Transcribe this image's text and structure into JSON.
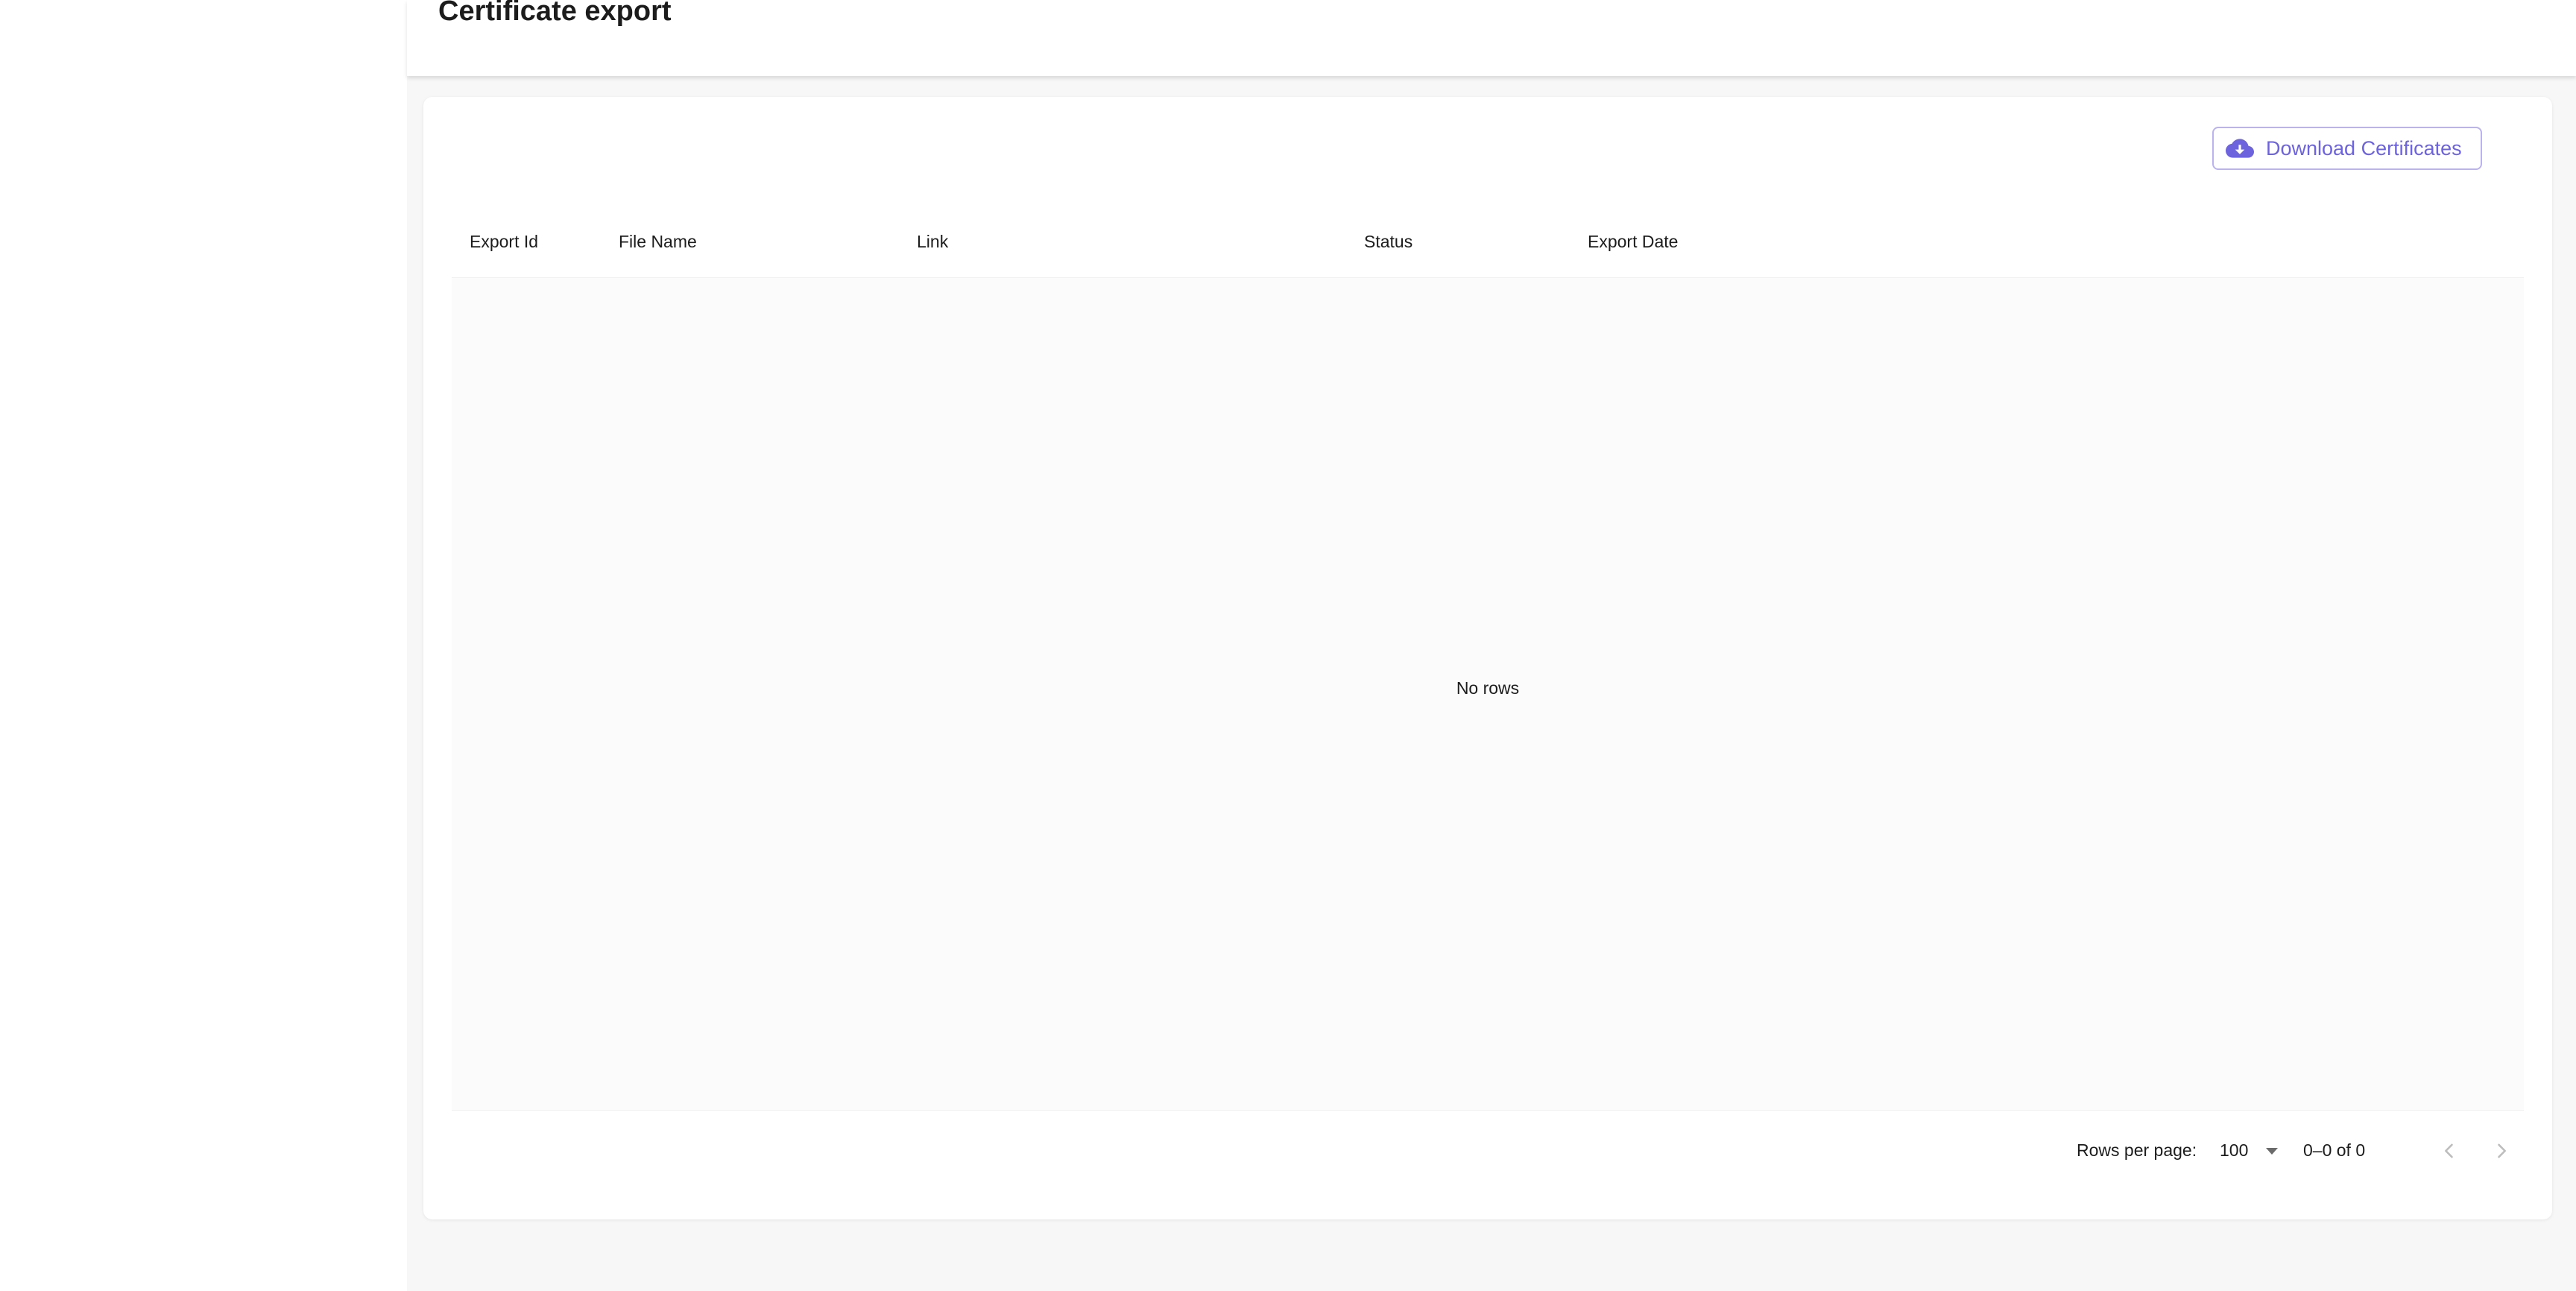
{
  "page": {
    "title": "Certificate export"
  },
  "toolbar": {
    "download_label": "Download Certificates",
    "download_icon": "cloud-download-icon"
  },
  "table": {
    "columns": [
      "Export Id",
      "File Name",
      "Link",
      "Status",
      "Export Date"
    ],
    "rows": [],
    "empty_text": "No rows"
  },
  "pagination": {
    "rows_per_page_label": "Rows per page:",
    "rows_per_page_value": "100",
    "range_text": "0–0 of 0",
    "prev_icon": "chevron-left-icon",
    "next_icon": "chevron-right-icon"
  },
  "colors": {
    "accent": "#6d63dc",
    "accent_border": "#b9b3ee",
    "background": "#f7f7f7",
    "card": "#ffffff"
  }
}
